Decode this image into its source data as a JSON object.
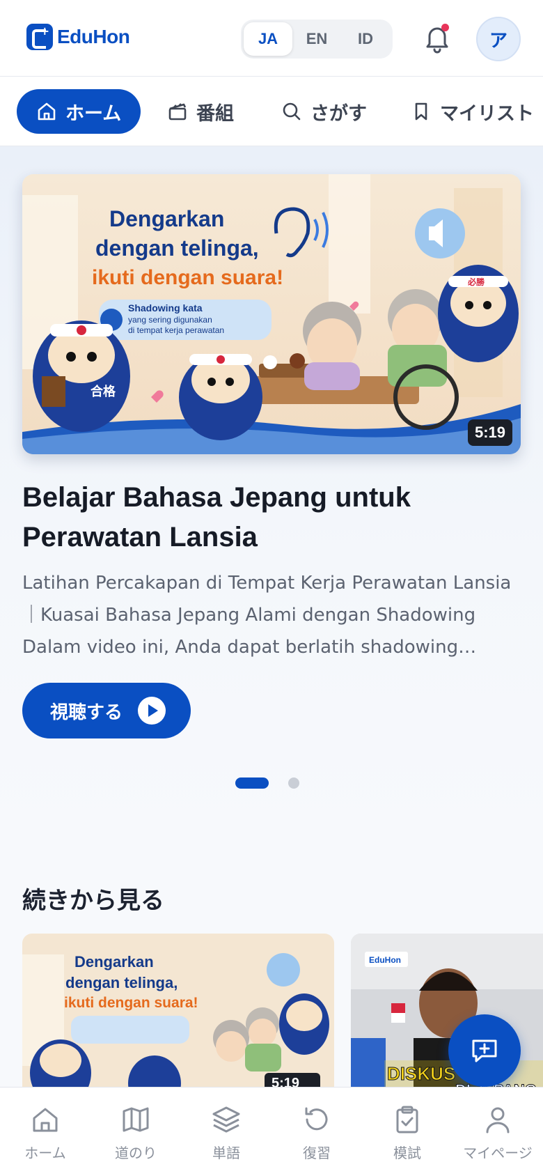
{
  "header": {
    "logo_text": "EduHon",
    "languages": [
      "JA",
      "EN",
      "ID"
    ],
    "active_language": "JA",
    "avatar_initial": "ア",
    "has_notification": true
  },
  "nav": {
    "tabs": [
      {
        "label": "ホーム",
        "icon": "home-icon",
        "active": true
      },
      {
        "label": "番組",
        "icon": "clapperboard-icon",
        "active": false
      },
      {
        "label": "さがす",
        "icon": "search-icon",
        "active": false
      },
      {
        "label": "マイリスト",
        "icon": "bookmark-icon",
        "active": false
      }
    ]
  },
  "hero": {
    "thumbnail": {
      "headline_line1": "Dengarkan",
      "headline_line2": "dengan telinga,",
      "headline_line3": "ikuti dengan suara!",
      "caption_line1": "Shadowing kata",
      "caption_line2": "yang sering digunakan",
      "caption_line3": "di tempat kerja perawatan",
      "badge_kanji": "必勝",
      "body_kanji": "合格"
    },
    "duration": "5:19",
    "title": "Belajar Bahasa Jepang untuk Perawatan Lansia",
    "description": "Latihan Percakapan di Tempat Kerja Perawatan Lansia ｜Kuasai Bahasa Jepang Alami dengan Shadowing Dalam video ini, Anda dapat berlatih shadowing…",
    "play_label": "視聴する",
    "carousel_pages": 2,
    "carousel_current": 1
  },
  "continue_section": {
    "title": "続きから見る",
    "cards": [
      {
        "duration": "5:19",
        "headline_line1": "Dengarkan",
        "headline_line2": "dengan telinga,",
        "headline_line3": "ikuti dengan suara!"
      },
      {
        "logo_text": "EduHon",
        "banner_text": "DISKUS",
        "banner_text2": "DI JEPANG"
      }
    ]
  },
  "bottom_nav": {
    "items": [
      {
        "label": "ホーム",
        "icon": "home-icon"
      },
      {
        "label": "道のり",
        "icon": "map-icon"
      },
      {
        "label": "単語",
        "icon": "layers-icon"
      },
      {
        "label": "復習",
        "icon": "rotate-icon"
      },
      {
        "label": "模試",
        "icon": "clipboard-check-icon"
      },
      {
        "label": "マイページ",
        "icon": "user-icon"
      }
    ]
  },
  "colors": {
    "primary": "#0a4fc2",
    "accent_orange": "#e56a1d",
    "notification": "#e8355a"
  }
}
